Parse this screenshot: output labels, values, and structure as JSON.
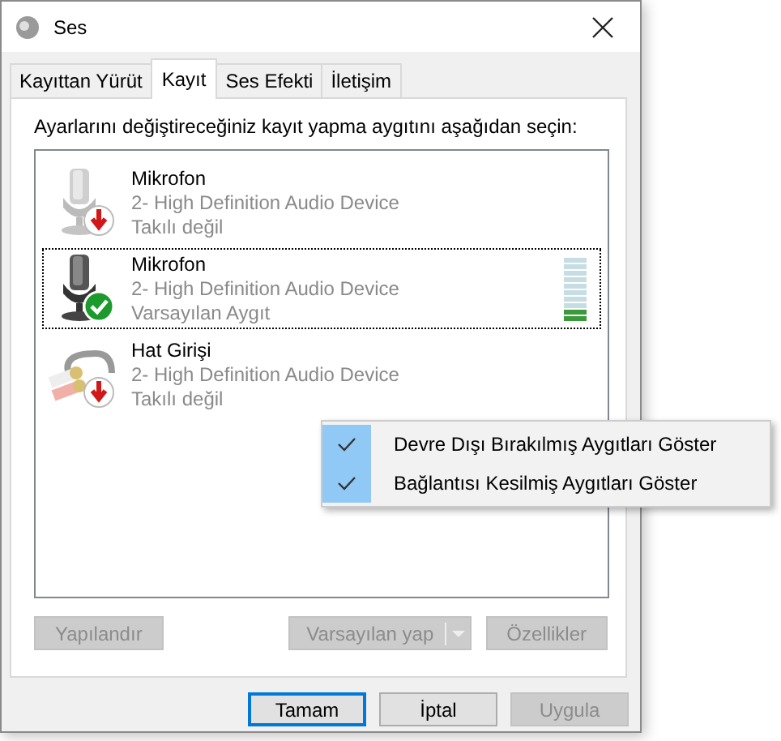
{
  "window": {
    "title": "Ses"
  },
  "tabs": [
    {
      "label": "Kayıttan Yürüt",
      "selected": false
    },
    {
      "label": "Kayıt",
      "selected": true
    },
    {
      "label": "Ses Efekti",
      "selected": false
    },
    {
      "label": "İletişim",
      "selected": false
    }
  ],
  "instruction": "Ayarlarını değiştireceğiniz kayıt yapma aygıtını aşağıdan seçin:",
  "devices": [
    {
      "kind": "microphone",
      "name": "Mikrofon",
      "description": "2- High Definition Audio Device",
      "status": "Takılı değil",
      "connected": false,
      "selected": false
    },
    {
      "kind": "microphone",
      "name": "Mikrofon",
      "description": "2- High Definition Audio Device",
      "status": "Varsayılan Aygıt",
      "connected": true,
      "selected": true,
      "level": 0.2
    },
    {
      "kind": "line-in",
      "name": "Hat Girişi",
      "description": "2- High Definition Audio Device",
      "status": "Takılı değil",
      "connected": false,
      "selected": false
    }
  ],
  "context_menu": [
    {
      "label": "Devre Dışı Bırakılmış Aygıtları Göster",
      "checked": true
    },
    {
      "label": "Bağlantısı Kesilmiş Aygıtları Göster",
      "checked": true
    }
  ],
  "panel_buttons": [
    {
      "label": "Yapılandır",
      "disabled": true,
      "split": false
    },
    {
      "label": "Varsayılan yap",
      "disabled": true,
      "split": true
    },
    {
      "label": "Özellikler",
      "disabled": true,
      "split": false
    }
  ],
  "dialog_buttons": [
    {
      "label": "Tamam",
      "disabled": false,
      "default": true
    },
    {
      "label": "İptal",
      "disabled": false,
      "default": false
    },
    {
      "label": "Uygula",
      "disabled": true,
      "default": false
    }
  ]
}
